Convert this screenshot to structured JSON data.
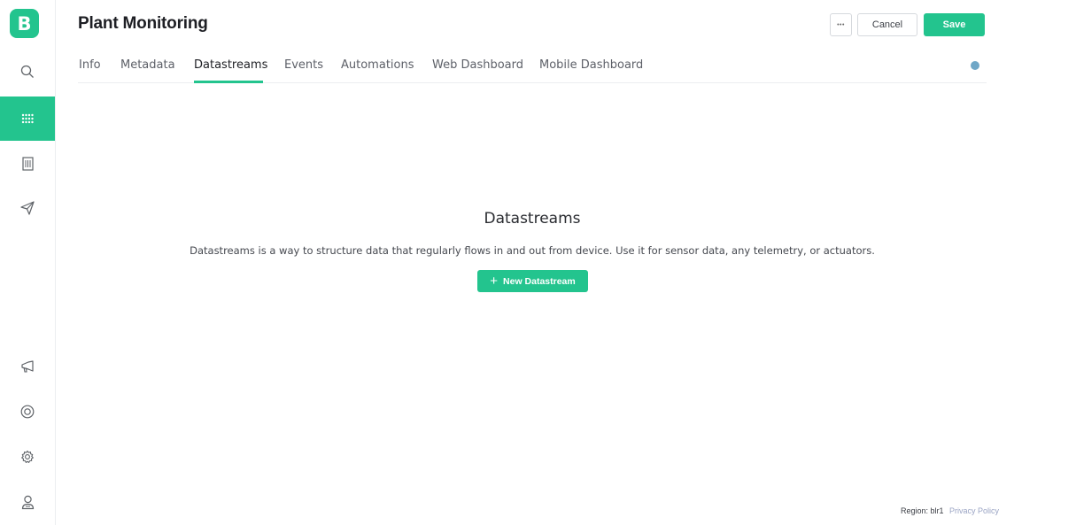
{
  "sidebar": {
    "logo_letter": "B",
    "items": [
      {
        "name": "search-icon",
        "active": false
      },
      {
        "name": "templates-grid-icon",
        "active": true
      },
      {
        "name": "organization-icon",
        "active": false
      },
      {
        "name": "send-icon",
        "active": false
      }
    ],
    "bottom_items": [
      {
        "name": "announcement-icon"
      },
      {
        "name": "help-icon"
      },
      {
        "name": "settings-icon"
      },
      {
        "name": "user-icon"
      }
    ]
  },
  "header": {
    "title": "Plant Monitoring",
    "more_label": "•••",
    "cancel_label": "Cancel",
    "save_label": "Save"
  },
  "tabs": [
    {
      "label": "Info",
      "active": false
    },
    {
      "label": "Metadata",
      "active": false
    },
    {
      "label": "Datastreams",
      "active": true
    },
    {
      "label": "Events",
      "active": false
    },
    {
      "label": "Automations",
      "active": false
    },
    {
      "label": "Web Dashboard",
      "active": false
    },
    {
      "label": "Mobile Dashboard",
      "active": false
    }
  ],
  "empty_state": {
    "title": "Datastreams",
    "description": "Datastreams is a way to structure data that regularly flows in and out from device. Use it for sensor data, any telemetry, or actuators.",
    "button_label": "New Datastream"
  },
  "footer": {
    "region": "Region: blr1",
    "privacy": "Privacy Policy"
  },
  "colors": {
    "accent": "#23c48e",
    "info_dot": "#6fa7c7"
  }
}
